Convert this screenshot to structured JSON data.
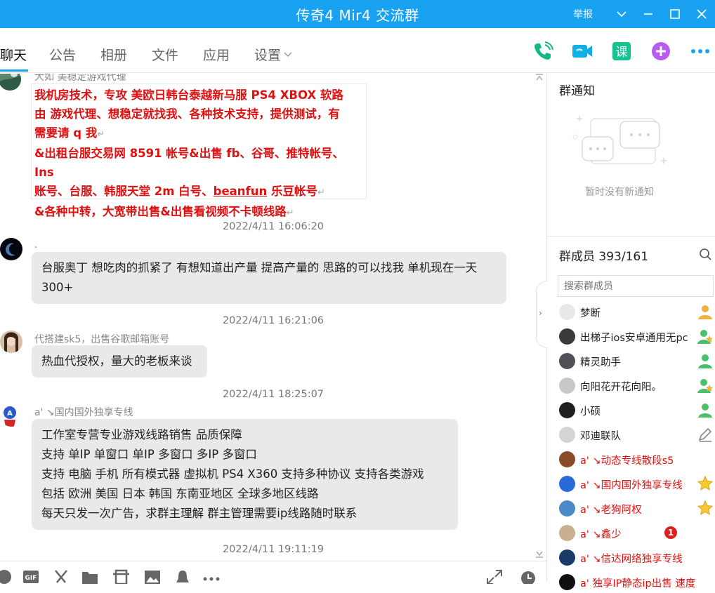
{
  "window": {
    "title": "传奇4 Mir4 交流群",
    "report_label": "举报"
  },
  "tabs": [
    {
      "label": "聊天"
    },
    {
      "label": "公告"
    },
    {
      "label": "相册"
    },
    {
      "label": "文件"
    },
    {
      "label": "应用"
    },
    {
      "label": "设置"
    }
  ],
  "toolbar_icons": [
    "phone-icon",
    "video-icon",
    "course-icon",
    "add-app-icon",
    "more-icon"
  ],
  "chat": {
    "first_sender_partial": "大如 美稳定游戏代理",
    "red_message": {
      "line1": "我机房技术，专攻 美欧日韩台泰越新马服 PS4 XBOX 软路",
      "line2": "由 游戏代理、想稳定就找我、各种技术支持，提供测试，有",
      "line3": "需要请 q 我",
      "line4": "&出租台服交易网 8591 帐号&出售 fb、谷哥、推特帐号、Ins",
      "line5a": "账号、台服、韩服天堂 2m 白号、",
      "line5b": "beanfun",
      "line5c": " 乐豆帐号",
      "line6": "&各种中转，大宽带出售&出售看视频不卡顿线路",
      "return_mark": "↵"
    },
    "messages": [
      {
        "time": "2022/4/11 16:06:20",
        "sender": ".",
        "lines": [
          "台服奥丁 想吃肉的抓紧了 有想知道出产量  提高产量的 思路的可以找我  单机现在一天",
          "300+"
        ]
      },
      {
        "time": "2022/4/11 16:21:06",
        "sender": "代搭建sk5，出售谷歌邮箱账号",
        "lines": [
          "热血代授权，量大的老板来谈"
        ]
      },
      {
        "time": "2022/4/11 18:25:07",
        "sender": "a' ↘国内国外独享专线",
        "lines": [
          "工作室专营专业游戏线路销售  品质保障",
          "支持 单IP 单窗口  单IP 多窗口   多IP 多窗口",
          "支持 电脑 手机  所有模式器 虚拟机   PS4    X360   支持多种协议 支持各类游戏",
          "包括  欧洲 美国 日本 韩国 东南亚地区 全球多地区线路",
          "每天只发一次广告，求群主理解 群主管理需要ip线路随时联系"
        ]
      }
    ],
    "last_time": "2022/4/11 19:11:19"
  },
  "input_toolbar_icons": [
    "emoji-icon",
    "gif-icon",
    "scissors-icon",
    "folder-icon",
    "screenshot-icon",
    "image-icon",
    "bell-icon",
    "more-icon",
    "expand-icon",
    "history-icon"
  ],
  "right_panel": {
    "notice_title": "群通知",
    "notice_empty": "暂时没有新通知",
    "members_title": "群成员 393/161",
    "search_placeholder": "搜索群成员",
    "members": [
      {
        "name": "梦断",
        "red": false,
        "role": "owner"
      },
      {
        "name": "出梯子ios安卓通用无pc",
        "red": false,
        "role": "admin"
      },
      {
        "name": "精灵助手",
        "red": false,
        "role": "admin-green"
      },
      {
        "name": "向阳花开花向阳。",
        "red": false,
        "role": "admin"
      },
      {
        "name": "小硕",
        "red": false,
        "role": "admin-green"
      },
      {
        "name": "邓迪联队",
        "red": false,
        "role": "edit"
      },
      {
        "name": "a' ↘动态专线散段s5",
        "red": true,
        "role": ""
      },
      {
        "name": "a' ↘国内国外独享专线",
        "red": true,
        "role": "star"
      },
      {
        "name": "a' ↘老狗阿权",
        "red": true,
        "role": "star"
      },
      {
        "name": "a' ↘鑫少",
        "red": true,
        "role": "",
        "badge": "1"
      },
      {
        "name": "a' ↘信达网络独享专线",
        "red": true,
        "role": ""
      },
      {
        "name": "a' 独享IP静态ip出售 速度",
        "red": true,
        "role": ""
      }
    ]
  },
  "colors": {
    "accent": "#1aa2f2",
    "red_text": "#e01010",
    "bubble": "#e9e9e9"
  }
}
